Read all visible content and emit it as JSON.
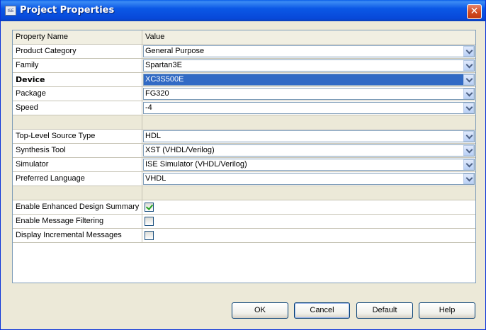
{
  "window": {
    "title": "Project Properties",
    "close_label": "✕"
  },
  "grid": {
    "header": {
      "name": "Property Name",
      "value": "Value"
    },
    "rows": [
      {
        "name": "Product Category",
        "value": "General Purpose"
      },
      {
        "name": "Family",
        "value": "Spartan3E"
      },
      {
        "name": "Device",
        "value": "XC3S500E"
      },
      {
        "name": "Package",
        "value": "FG320"
      },
      {
        "name": "Speed",
        "value": "-4"
      },
      {
        "name": "Top-Level Source Type",
        "value": "HDL"
      },
      {
        "name": "Synthesis Tool",
        "value": "XST (VHDL/Verilog)"
      },
      {
        "name": "Simulator",
        "value": "ISE Simulator (VHDL/Verilog)"
      },
      {
        "name": "Preferred Language",
        "value": "VHDL"
      },
      {
        "name": "Enable Enhanced Design Summary",
        "checked": true
      },
      {
        "name": "Enable Message Filtering",
        "checked": false
      },
      {
        "name": "Display Incremental Messages",
        "checked": false
      }
    ]
  },
  "buttons": {
    "ok": "OK",
    "cancel": "Cancel",
    "default": "Default",
    "help": "Help"
  }
}
